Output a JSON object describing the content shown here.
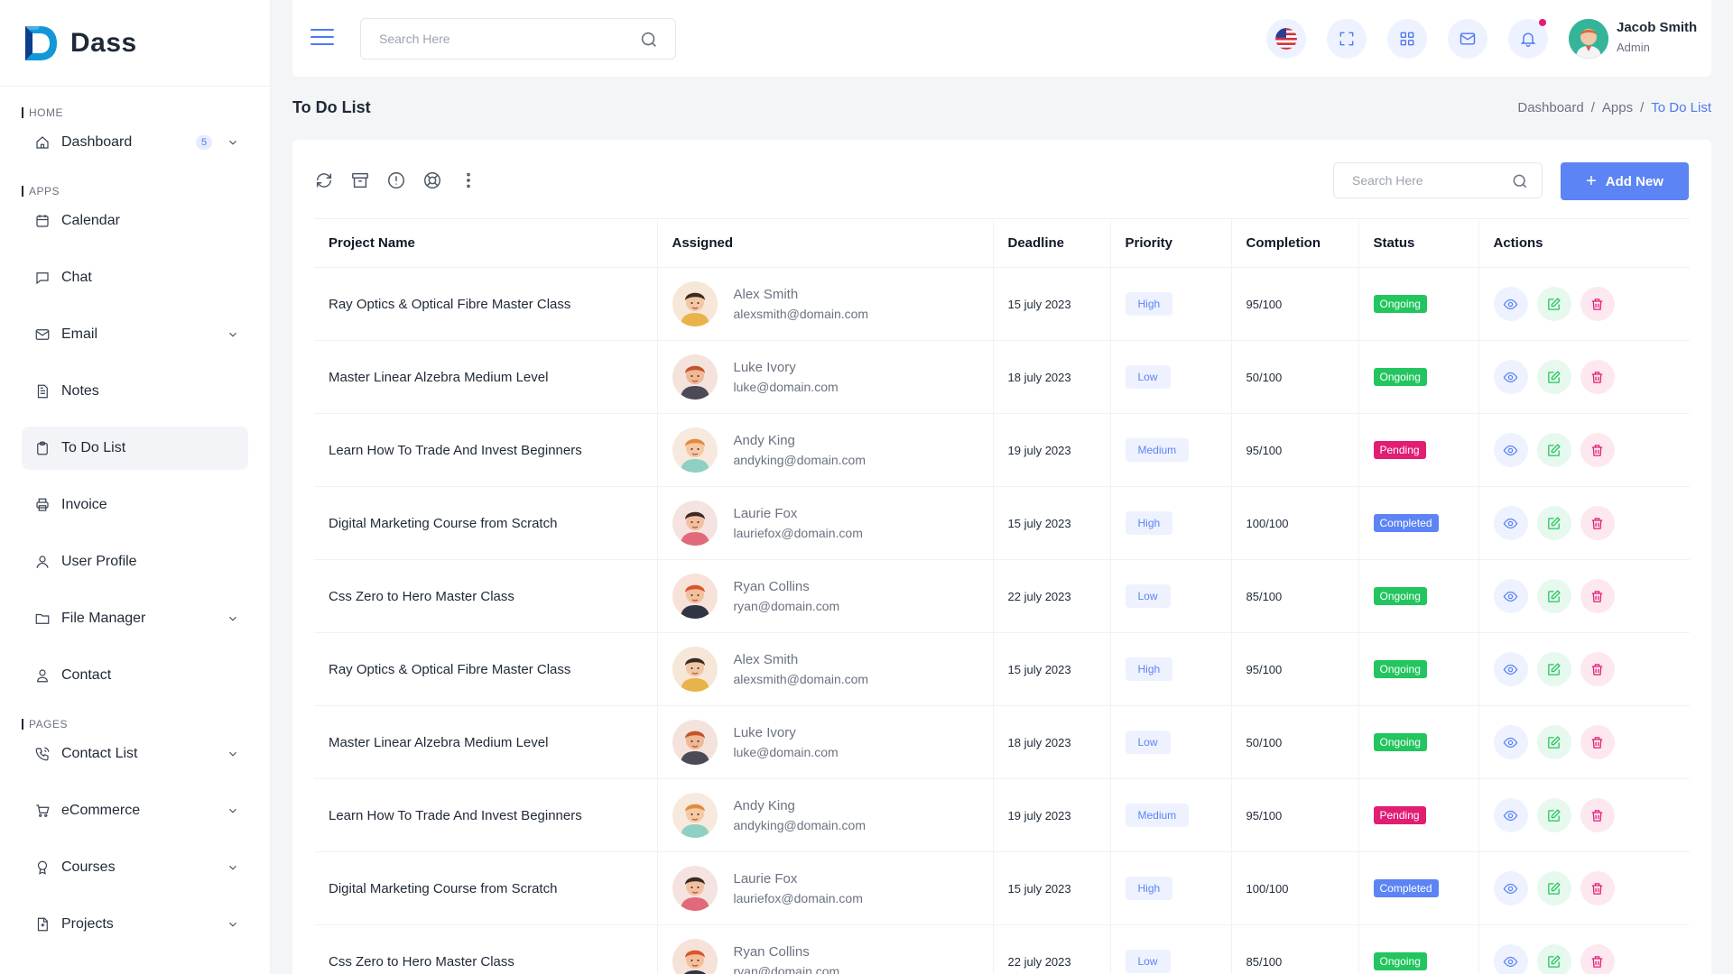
{
  "brand": {
    "name": "Dass",
    "accent": "#4f78f0"
  },
  "sidebar": {
    "sections": [
      {
        "label": "HOME"
      },
      {
        "label": "APPS"
      },
      {
        "label": "PAGES"
      }
    ],
    "items": [
      {
        "label": "Dashboard",
        "icon": "home-icon",
        "badge": "5",
        "expandable": true
      },
      {
        "label": "Calendar",
        "icon": "calendar-icon"
      },
      {
        "label": "Chat",
        "icon": "chat-icon"
      },
      {
        "label": "Email",
        "icon": "mail-icon",
        "expandable": true
      },
      {
        "label": "Notes",
        "icon": "notes-icon"
      },
      {
        "label": "To Do List",
        "icon": "clipboard-icon",
        "active": true
      },
      {
        "label": "Invoice",
        "icon": "printer-icon"
      },
      {
        "label": "User Profile",
        "icon": "user-icon"
      },
      {
        "label": "File Manager",
        "icon": "folder-icon",
        "expandable": true
      },
      {
        "label": "Contact",
        "icon": "contact-icon"
      },
      {
        "label": "Contact List",
        "icon": "phone-icon",
        "expandable": true
      },
      {
        "label": "eCommerce",
        "icon": "cart-icon",
        "expandable": true
      },
      {
        "label": "Courses",
        "icon": "award-icon",
        "expandable": true
      },
      {
        "label": "Projects",
        "icon": "file-icon",
        "expandable": true
      }
    ]
  },
  "header": {
    "search_placeholder": "Search Here",
    "user": {
      "name": "Jacob Smith",
      "role": "Admin"
    },
    "icons": [
      "us-flag-icon",
      "fullscreen-icon",
      "apps-grid-icon",
      "mail-icon",
      "bell-icon"
    ]
  },
  "page": {
    "title": "To Do List",
    "breadcrumb": [
      "Dashboard",
      "/",
      "Apps",
      "/",
      "To Do List"
    ]
  },
  "card": {
    "search_placeholder": "Search Here",
    "add_label": "Add New",
    "tools": [
      "refresh-icon",
      "archive-icon",
      "alert-icon",
      "lifebuoy-icon",
      "more-vertical-icon"
    ]
  },
  "table": {
    "headers": [
      "Project Name",
      "Assigned",
      "Deadline",
      "Priority",
      "Completion",
      "Status",
      "Actions"
    ],
    "rows": [
      {
        "project": "Ray Optics & Optical Fibre Master Class",
        "name": "Alex Smith",
        "email": "alexsmith@domain.com",
        "deadline": "15 july 2023",
        "priority": "High",
        "completion": "95/100",
        "status": "Ongoing",
        "avatar": "a"
      },
      {
        "project": "Master Linear Alzebra Medium Level",
        "name": "Luke Ivory",
        "email": "luke@domain.com",
        "deadline": "18 july 2023",
        "priority": "Low",
        "completion": "50/100",
        "status": "Ongoing",
        "avatar": "b"
      },
      {
        "project": "Learn How To Trade And Invest Beginners",
        "name": "Andy King",
        "email": "andyking@domain.com",
        "deadline": "19 july 2023",
        "priority": "Medium",
        "completion": "95/100",
        "status": "Pending",
        "avatar": "c"
      },
      {
        "project": "Digital Marketing Course from Scratch",
        "name": "Laurie Fox",
        "email": "lauriefox@domain.com",
        "deadline": "15 july 2023",
        "priority": "High",
        "completion": "100/100",
        "status": "Completed",
        "avatar": "d"
      },
      {
        "project": "Css Zero to Hero Master Class",
        "name": "Ryan Collins",
        "email": "ryan@domain.com",
        "deadline": "22 july 2023",
        "priority": "Low",
        "completion": "85/100",
        "status": "Ongoing",
        "avatar": "e"
      },
      {
        "project": "Ray Optics & Optical Fibre Master Class",
        "name": "Alex Smith",
        "email": "alexsmith@domain.com",
        "deadline": "15 july 2023",
        "priority": "High",
        "completion": "95/100",
        "status": "Ongoing",
        "avatar": "a"
      },
      {
        "project": "Master Linear Alzebra Medium Level",
        "name": "Luke Ivory",
        "email": "luke@domain.com",
        "deadline": "18 july 2023",
        "priority": "Low",
        "completion": "50/100",
        "status": "Ongoing",
        "avatar": "b"
      },
      {
        "project": "Learn How To Trade And Invest Beginners",
        "name": "Andy King",
        "email": "andyking@domain.com",
        "deadline": "19 july 2023",
        "priority": "Medium",
        "completion": "95/100",
        "status": "Pending",
        "avatar": "c"
      },
      {
        "project": "Digital Marketing Course from Scratch",
        "name": "Laurie Fox",
        "email": "lauriefox@domain.com",
        "deadline": "15 july 2023",
        "priority": "High",
        "completion": "100/100",
        "status": "Completed",
        "avatar": "d"
      },
      {
        "project": "Css Zero to Hero Master Class",
        "name": "Ryan Collins",
        "email": "ryan@domain.com",
        "deadline": "22 july 2023",
        "priority": "Low",
        "completion": "85/100",
        "status": "Ongoing",
        "avatar": "e"
      }
    ]
  },
  "colors": {
    "ongoing": "#22c55e",
    "pending": "#e11d74",
    "completed": "#5c84f5",
    "primary_button": "#5c84f5"
  }
}
